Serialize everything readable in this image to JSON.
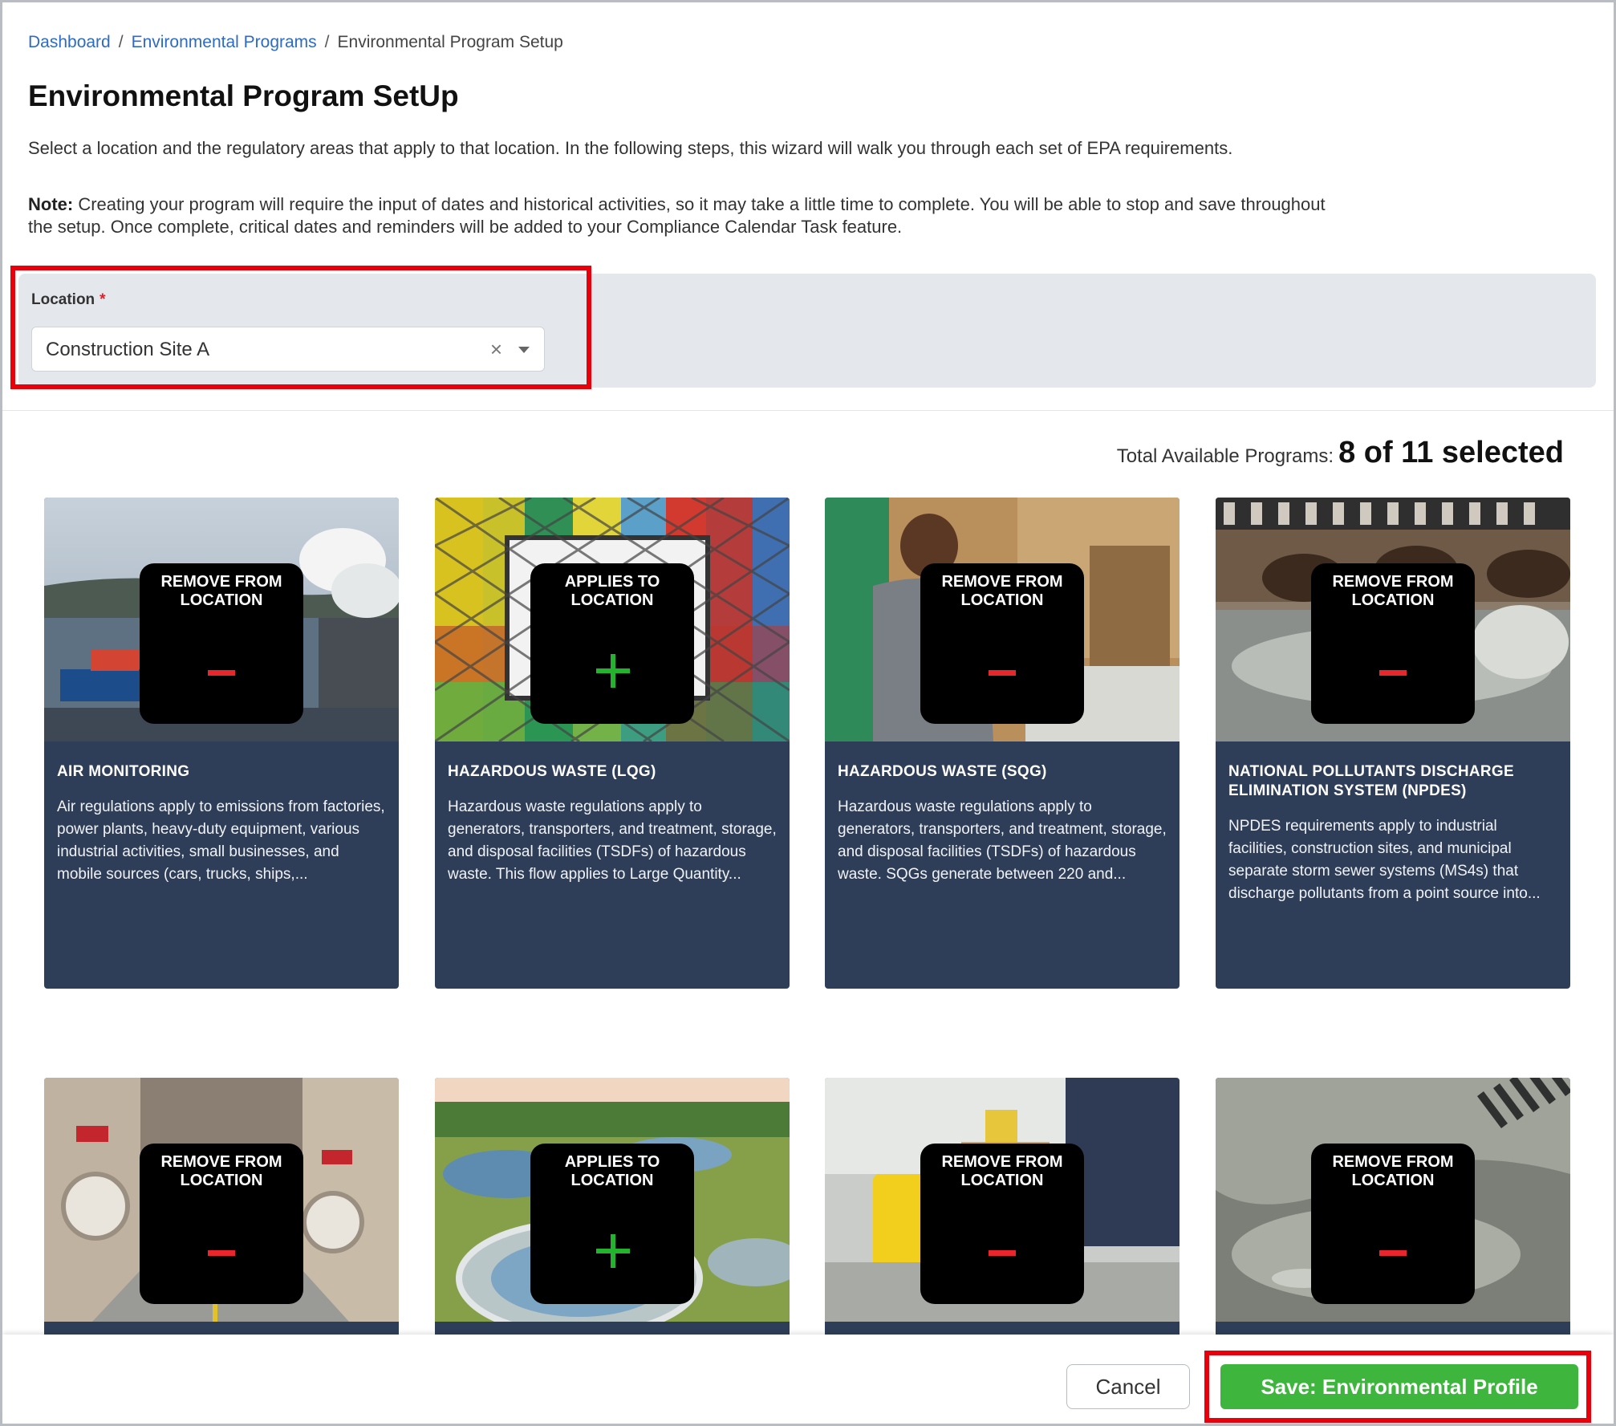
{
  "breadcrumb": {
    "items": [
      "Dashboard",
      "Environmental Programs",
      "Environmental Program Setup"
    ],
    "separator": "/"
  },
  "page": {
    "title": "Environmental Program SetUp",
    "intro": "Select a location and the regulatory areas that apply to that location. In the following steps, this wizard will walk you through each set of EPA requirements.",
    "note_label": "Note:",
    "note_text": " Creating your program will require the input of dates and historical activities, so it may take a little time to complete. You will be able to stop and save throughout the setup. Once complete, critical dates and reminders will be added to your Compliance Calendar Task feature."
  },
  "location": {
    "label": "Location",
    "required_mark": "*",
    "value": "Construction Site A",
    "clear_glyph": "×"
  },
  "programs_summary": {
    "label": "Total Available Programs:",
    "value": "8 of 11 selected"
  },
  "cards": [
    {
      "title": "Air Monitoring",
      "overlay": "REMOVE FROM LOCATION",
      "state": "remove",
      "description": "Air regulations apply to emissions from factories, power plants, heavy-duty equipment, various industrial activities, small businesses, and mobile sources (cars, trucks, ships,..."
    },
    {
      "title": "Hazardous Waste (LQG)",
      "overlay": "APPLIES TO LOCATION",
      "state": "add",
      "description": "Hazardous waste regulations apply to generators, transporters, and treatment, storage, and disposal facilities (TSDFs) of hazardous waste. This flow applies to Large Quantity..."
    },
    {
      "title": "Hazardous Waste (SQG)",
      "overlay": "REMOVE FROM LOCATION",
      "state": "remove",
      "description": "Hazardous waste regulations apply to generators, transporters, and treatment, storage, and disposal facilities (TSDFs) of hazardous waste. SQGs generate between 220 and..."
    },
    {
      "title": "National Pollutants Discharge Elimination System (NPDES)",
      "overlay": "REMOVE FROM LOCATION",
      "state": "remove",
      "description": "NPDES requirements apply to industrial facilities, construction sites, and municipal separate storm sewer systems (MS4s) that discharge pollutants from a point source into..."
    },
    {
      "title": "",
      "overlay": "REMOVE FROM LOCATION",
      "state": "remove",
      "description": ""
    },
    {
      "title": "",
      "overlay": "APPLIES TO LOCATION",
      "state": "add",
      "description": ""
    },
    {
      "title": "",
      "overlay": "REMOVE FROM LOCATION",
      "state": "remove",
      "description": ""
    },
    {
      "title": "",
      "overlay": "REMOVE FROM LOCATION",
      "state": "remove",
      "description": ""
    }
  ],
  "footer": {
    "cancel_label": "Cancel",
    "save_label": "Save: Environmental Profile"
  },
  "colors": {
    "highlight": "#e8000b",
    "save_button": "#3eb63e",
    "card_background": "#2f3e58",
    "link": "#2d6bc4",
    "remove_icon": "#e8262b",
    "add_icon": "#23b32d"
  },
  "icons": {
    "remove": "minus-icon",
    "add": "plus-icon",
    "clear": "clear-icon",
    "dropdown": "chevron-down-icon"
  }
}
